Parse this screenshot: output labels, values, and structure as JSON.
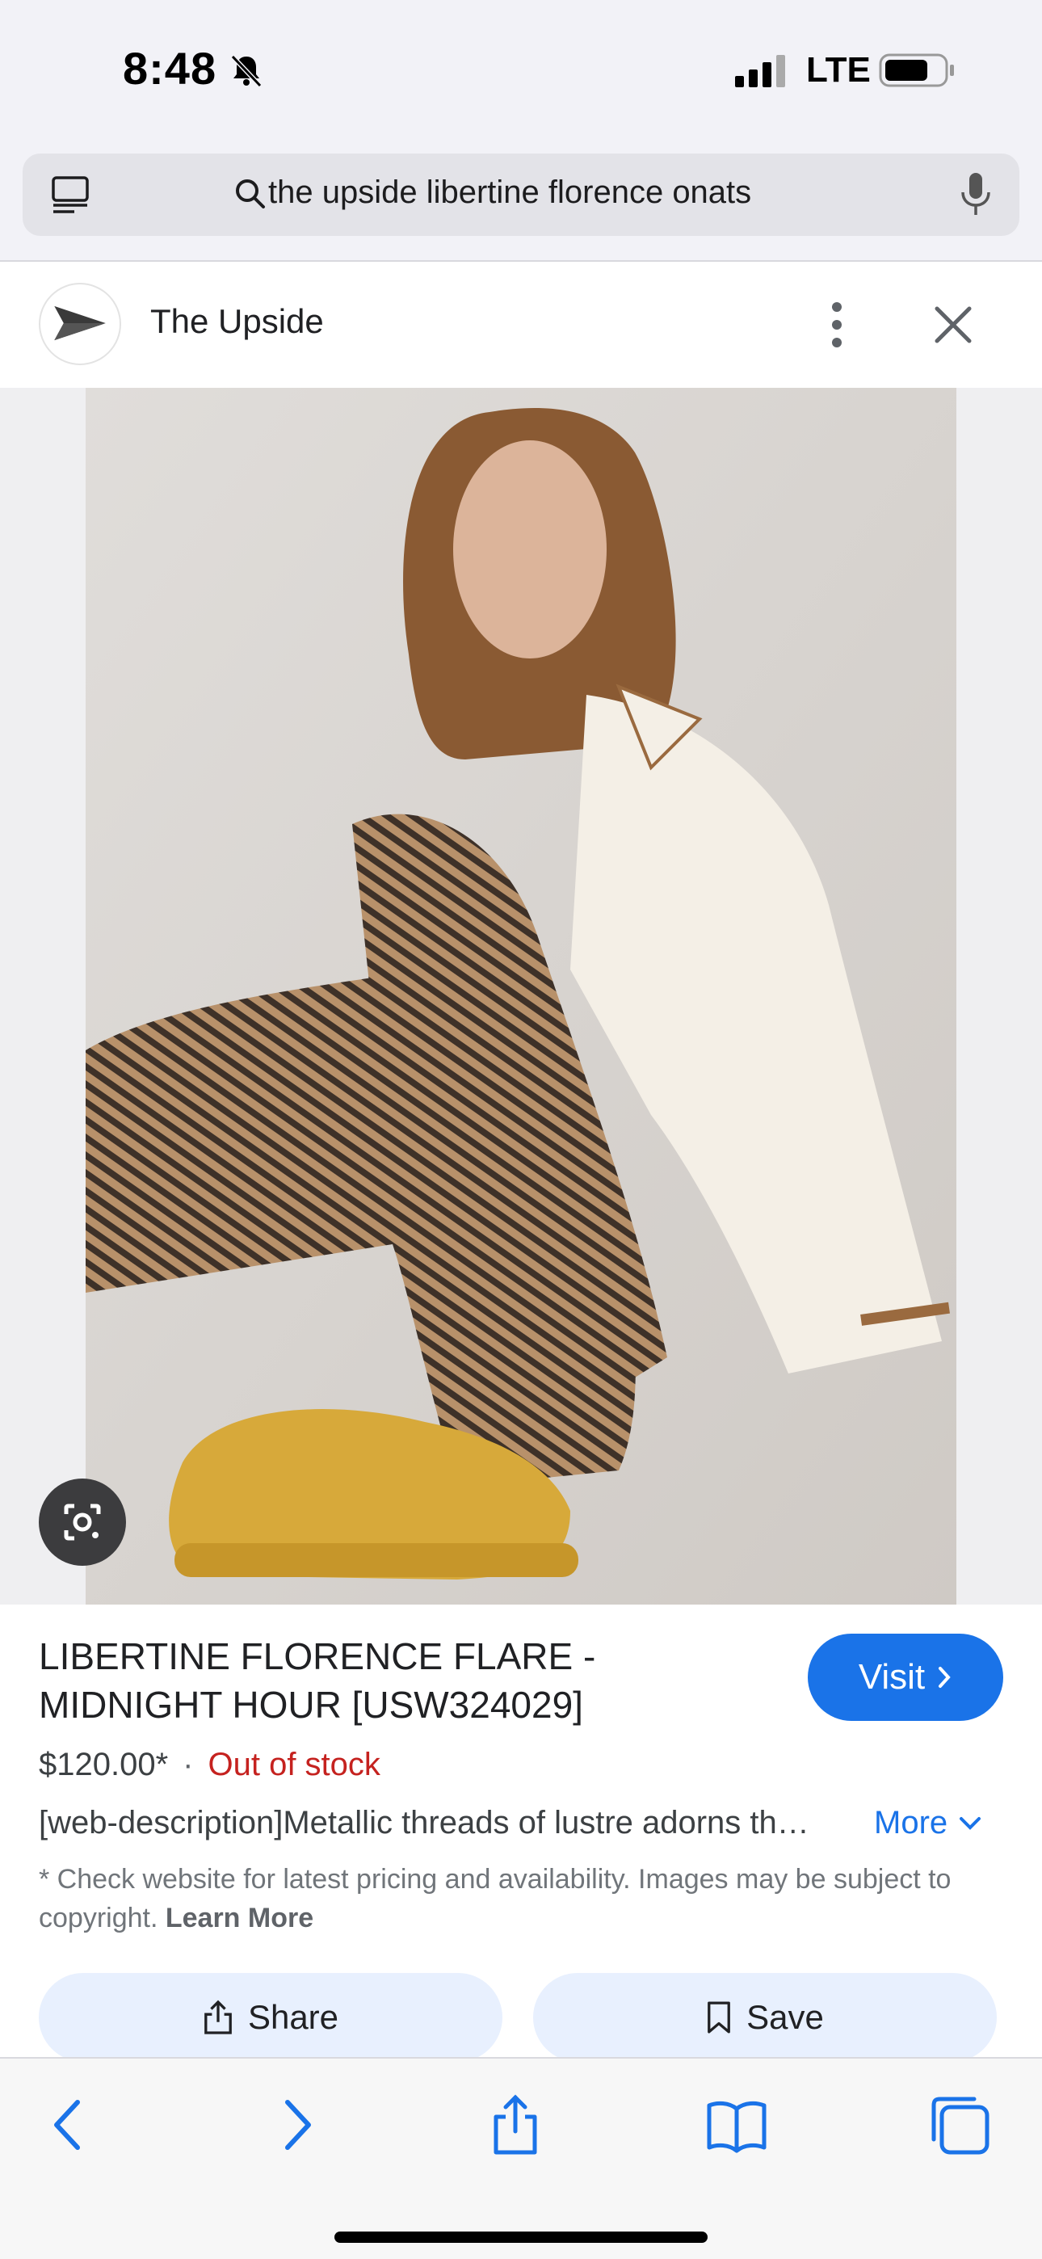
{
  "status_bar": {
    "time": "8:48",
    "network": "LTE"
  },
  "search": {
    "query": "the upside libertine florence onats"
  },
  "viewer": {
    "site_name": "The Upside"
  },
  "product": {
    "title": "LIBERTINE FLORENCE FLARE - MIDNIGHT HOUR [USW324029]",
    "visit_label": "Visit",
    "price": "$120.00*",
    "separator": "·",
    "stock_status": "Out of stock",
    "description": "[web-description]Metallic threads of lustre adorns th…",
    "more_label": "More",
    "disclaimer": "* Check website for latest pricing and availability. Images may be subject to copyright.",
    "learn_more": "Learn More"
  },
  "actions": {
    "share_label": "Share",
    "save_label": "Save"
  },
  "colors": {
    "accent": "#1a73e8",
    "out_of_stock": "#c5221f",
    "chip_bg": "#e8f0fe"
  },
  "icons": [
    "bell-slash-icon",
    "signal-icon",
    "battery-icon",
    "tabs-icon",
    "search-icon",
    "mic-icon",
    "more-vert-icon",
    "close-icon",
    "lens-icon",
    "chevron-right-icon",
    "chevron-down-icon",
    "share-icon",
    "bookmark-icon",
    "back-icon",
    "forward-icon",
    "bookmarks-book-icon",
    "tab-switcher-icon"
  ]
}
